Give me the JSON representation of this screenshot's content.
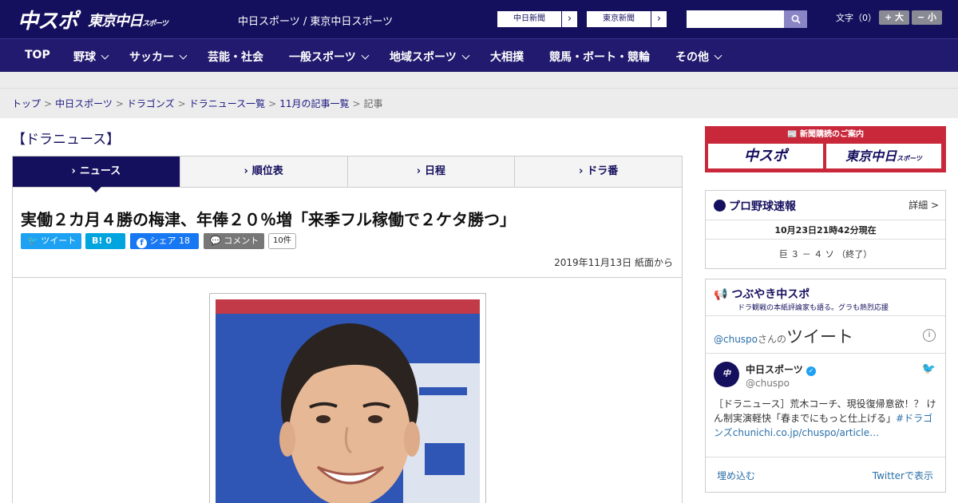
{
  "header": {
    "logo_main": "中スポ",
    "logo_tokyo": "東京中日",
    "logo_tokyo_small": "スポーツ",
    "site_name": "中日スポーツ / 東京中日スポーツ",
    "paper_buttons": [
      "中日新聞",
      "東京新聞"
    ],
    "search_placeholder": "",
    "font_size_label": "文字（0）",
    "font_bigger": "+ 大",
    "font_smaller": "− 小"
  },
  "nav": {
    "items": [
      {
        "label": "TOP",
        "has_menu": false
      },
      {
        "label": "野球",
        "has_menu": true
      },
      {
        "label": "サッカー",
        "has_menu": true
      },
      {
        "label": "芸能・社会",
        "has_menu": false
      },
      {
        "label": "一般スポーツ",
        "has_menu": true
      },
      {
        "label": "地域スポーツ",
        "has_menu": true
      },
      {
        "label": "大相撲",
        "has_menu": false
      },
      {
        "label": "競馬・ボート・競輪",
        "has_menu": false
      },
      {
        "label": "その他",
        "has_menu": true
      }
    ]
  },
  "breadcrumb": [
    "トップ",
    "中日スポーツ",
    "ドラゴンズ",
    "ドラニュース一覧",
    "11月の記事一覧",
    "記事"
  ],
  "section_title": "【ドラニュース】",
  "tabs": [
    {
      "label": "ニュース",
      "active": true
    },
    {
      "label": "順位表",
      "active": false
    },
    {
      "label": "日程",
      "active": false
    },
    {
      "label": "ドラ番",
      "active": false
    }
  ],
  "article": {
    "headline": "実働２カ月４勝の梅津、年俸２０％増「来季フル稼働で２ケタ勝つ」",
    "share": {
      "tweet": "ツイート",
      "hatena_label": "B!",
      "hatena_count": "0",
      "facebook": "シェア",
      "facebook_count": "18",
      "comment": "コメント",
      "comment_count": "10件"
    },
    "date": "2019年11月13日 紙面から"
  },
  "sidebar": {
    "ad": {
      "title": "新聞購読のご案内",
      "left": "中スポ",
      "right": "東京中日",
      "right_small": "スポーツ"
    },
    "scores": {
      "title": "プロ野球速報",
      "detail": "詳細 >",
      "as_of": "10月23日21時42分現在",
      "game": "巨 ３ － ４ ソ （終了）"
    },
    "tweets": {
      "title": "つぶやき中スポ",
      "subtitle": "ドラ観戦の本紙評論家も語る。グラも熱烈応援",
      "handle_prefix": "@chuspo",
      "handle_suffix": "さんの",
      "header_big": "ツイート",
      "account_name": "中日スポーツ",
      "account_handle": "@chuspo",
      "tweet_text": "［ドラニュース］荒木コーチ、現役復帰意欲！？ けん制実演軽快「春までにもっと仕上げる」",
      "tweet_hashtag": "#ドラゴンズ",
      "tweet_link": "chunichi.co.jp/chuspo/article…",
      "embed": "埋め込む",
      "view_on": "Twitterで表示"
    }
  },
  "colors": {
    "header_bg": "#15105e",
    "nav_bg": "#221a6e",
    "ad_red": "#c9283a",
    "twitter_blue": "#1da1f2",
    "hatena_blue": "#00a4de",
    "facebook_blue": "#1877f2"
  }
}
